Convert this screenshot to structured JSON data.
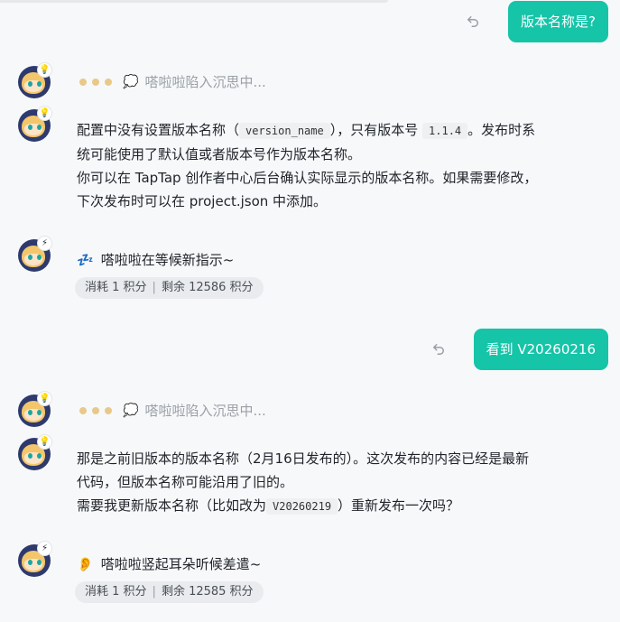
{
  "messages": {
    "user1": "版本名称是?",
    "thinking1": "嗒啦啦陷入沉思中...",
    "answer1": {
      "p1_a": "配置中没有设置版本名称（",
      "p1_code1": "version_name",
      "p1_b": "），只有版本号",
      "p1_code2": "1.1.4",
      "p1_c": "。发布时系统可能使用了默认值或者版本号作为版本名称。",
      "p2": "你可以在 TapTap 创作者中心后台确认实际显示的版本名称。如果需要修改，下次发布时可以在 project.json 中添加。"
    },
    "status1": "嗒啦啦在等候新指示~",
    "credits1": {
      "consumed": "消耗 1 积分",
      "separator": "|",
      "remaining": "剩余 12586 积分"
    },
    "user2": "看到 V20260216",
    "thinking2": "嗒啦啦陷入沉思中...",
    "answer2": {
      "p1": "那是之前旧版本的版本名称（2月16日发布的）。这次发布的内容已经是最新代码，但版本名称可能沿用了旧的。",
      "p2_a": "需要我更新版本名称（比如改为",
      "p2_code": "V20260219",
      "p2_b": "）重新发布一次吗？"
    },
    "status2": "嗒啦啦竖起耳朵听候差遣~",
    "credits2": {
      "consumed": "消耗 1 积分",
      "separator": "|",
      "remaining": "剩余 12585 积分"
    }
  },
  "icons": {
    "retry": "retry-icon",
    "thinking_bubble": "💭",
    "status1_icon": "💤",
    "status2_icon": "👂",
    "badge_thinking": "💡",
    "badge_status": "⚡"
  },
  "colors": {
    "accent": "#16c4a8",
    "background": "#f7f8fa",
    "dots": "#e8c98a"
  }
}
